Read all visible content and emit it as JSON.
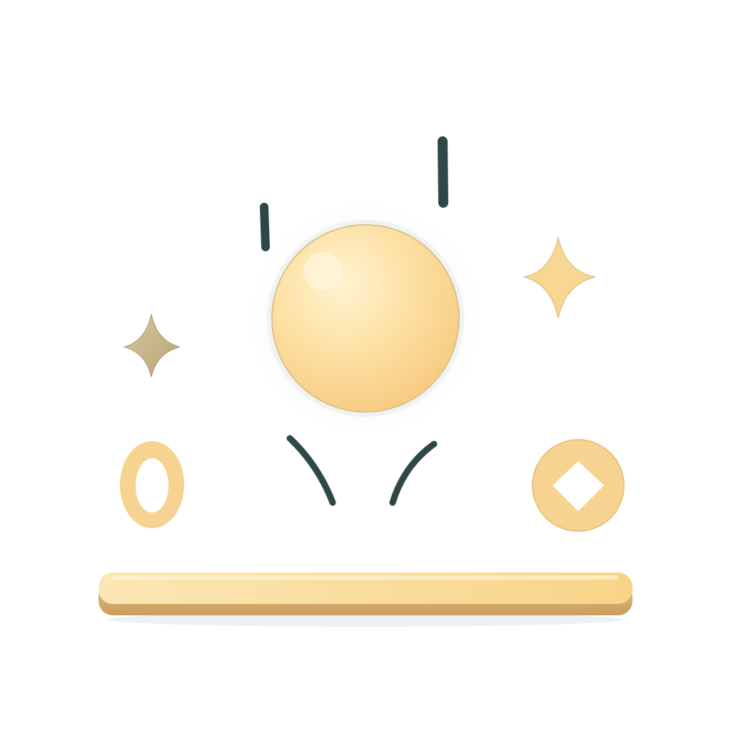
{
  "illustration": {
    "icons": {
      "orb": "orb-icon",
      "sparkle_left": "sparkle-icon",
      "sparkle_right": "sparkle-icon",
      "ring_oval": "oval-ring-icon",
      "coin": "diamond-coin-icon",
      "platform": "platform-bar-icon",
      "motion_lines": "motion-lines-icon"
    },
    "colors": {
      "background": "#ffffff",
      "gold_light": "#fdebb8",
      "gold_mid": "#f8d58f",
      "gold_dark": "#d9b47a",
      "sparkle_left": "#c9b68a",
      "ink": "#2f4747",
      "glow": "#eef1f1"
    }
  }
}
